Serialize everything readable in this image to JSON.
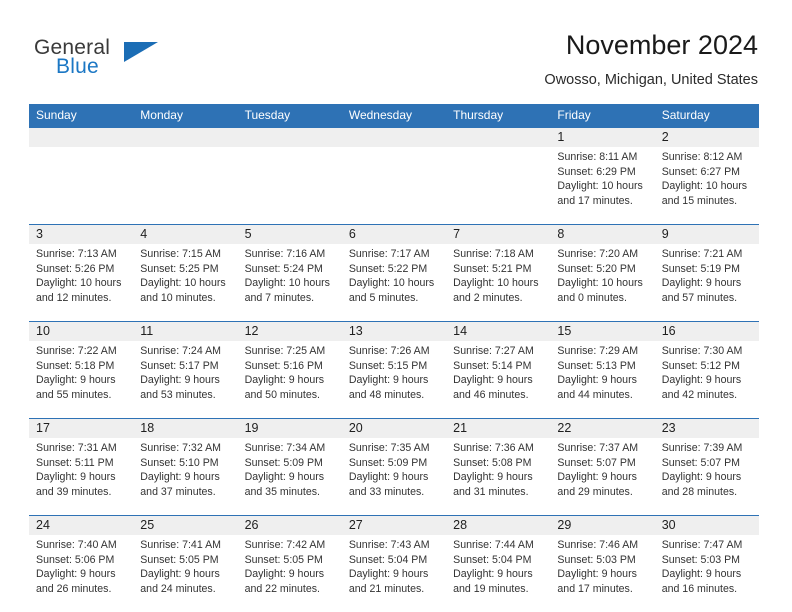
{
  "brand": {
    "name_top": "General",
    "name_bottom": "Blue",
    "logo_icon": "triangle-flag-icon",
    "accent_color": "#1b77c4"
  },
  "header": {
    "title": "November 2024",
    "location": "Owosso, Michigan, United States"
  },
  "theme": {
    "header_blue": "#2e72b5",
    "row_band_gray": "#efefef",
    "text": "#333333"
  },
  "weekday_headers": [
    "Sunday",
    "Monday",
    "Tuesday",
    "Wednesday",
    "Thursday",
    "Friday",
    "Saturday"
  ],
  "weeks": [
    {
      "days": [
        {
          "date": "",
          "empty": true,
          "sunrise": "",
          "sunset": "",
          "daylight_1": "",
          "daylight_2": ""
        },
        {
          "date": "",
          "empty": true,
          "sunrise": "",
          "sunset": "",
          "daylight_1": "",
          "daylight_2": ""
        },
        {
          "date": "",
          "empty": true,
          "sunrise": "",
          "sunset": "",
          "daylight_1": "",
          "daylight_2": ""
        },
        {
          "date": "",
          "empty": true,
          "sunrise": "",
          "sunset": "",
          "daylight_1": "",
          "daylight_2": ""
        },
        {
          "date": "",
          "empty": true,
          "sunrise": "",
          "sunset": "",
          "daylight_1": "",
          "daylight_2": ""
        },
        {
          "date": "1",
          "empty": false,
          "sunrise": "Sunrise: 8:11 AM",
          "sunset": "Sunset: 6:29 PM",
          "daylight_1": "Daylight: 10 hours",
          "daylight_2": "and 17 minutes."
        },
        {
          "date": "2",
          "empty": false,
          "sunrise": "Sunrise: 8:12 AM",
          "sunset": "Sunset: 6:27 PM",
          "daylight_1": "Daylight: 10 hours",
          "daylight_2": "and 15 minutes."
        }
      ]
    },
    {
      "days": [
        {
          "date": "3",
          "empty": false,
          "sunrise": "Sunrise: 7:13 AM",
          "sunset": "Sunset: 5:26 PM",
          "daylight_1": "Daylight: 10 hours",
          "daylight_2": "and 12 minutes."
        },
        {
          "date": "4",
          "empty": false,
          "sunrise": "Sunrise: 7:15 AM",
          "sunset": "Sunset: 5:25 PM",
          "daylight_1": "Daylight: 10 hours",
          "daylight_2": "and 10 minutes."
        },
        {
          "date": "5",
          "empty": false,
          "sunrise": "Sunrise: 7:16 AM",
          "sunset": "Sunset: 5:24 PM",
          "daylight_1": "Daylight: 10 hours",
          "daylight_2": "and 7 minutes."
        },
        {
          "date": "6",
          "empty": false,
          "sunrise": "Sunrise: 7:17 AM",
          "sunset": "Sunset: 5:22 PM",
          "daylight_1": "Daylight: 10 hours",
          "daylight_2": "and 5 minutes."
        },
        {
          "date": "7",
          "empty": false,
          "sunrise": "Sunrise: 7:18 AM",
          "sunset": "Sunset: 5:21 PM",
          "daylight_1": "Daylight: 10 hours",
          "daylight_2": "and 2 minutes."
        },
        {
          "date": "8",
          "empty": false,
          "sunrise": "Sunrise: 7:20 AM",
          "sunset": "Sunset: 5:20 PM",
          "daylight_1": "Daylight: 10 hours",
          "daylight_2": "and 0 minutes."
        },
        {
          "date": "9",
          "empty": false,
          "sunrise": "Sunrise: 7:21 AM",
          "sunset": "Sunset: 5:19 PM",
          "daylight_1": "Daylight: 9 hours",
          "daylight_2": "and 57 minutes."
        }
      ]
    },
    {
      "days": [
        {
          "date": "10",
          "empty": false,
          "sunrise": "Sunrise: 7:22 AM",
          "sunset": "Sunset: 5:18 PM",
          "daylight_1": "Daylight: 9 hours",
          "daylight_2": "and 55 minutes."
        },
        {
          "date": "11",
          "empty": false,
          "sunrise": "Sunrise: 7:24 AM",
          "sunset": "Sunset: 5:17 PM",
          "daylight_1": "Daylight: 9 hours",
          "daylight_2": "and 53 minutes."
        },
        {
          "date": "12",
          "empty": false,
          "sunrise": "Sunrise: 7:25 AM",
          "sunset": "Sunset: 5:16 PM",
          "daylight_1": "Daylight: 9 hours",
          "daylight_2": "and 50 minutes."
        },
        {
          "date": "13",
          "empty": false,
          "sunrise": "Sunrise: 7:26 AM",
          "sunset": "Sunset: 5:15 PM",
          "daylight_1": "Daylight: 9 hours",
          "daylight_2": "and 48 minutes."
        },
        {
          "date": "14",
          "empty": false,
          "sunrise": "Sunrise: 7:27 AM",
          "sunset": "Sunset: 5:14 PM",
          "daylight_1": "Daylight: 9 hours",
          "daylight_2": "and 46 minutes."
        },
        {
          "date": "15",
          "empty": false,
          "sunrise": "Sunrise: 7:29 AM",
          "sunset": "Sunset: 5:13 PM",
          "daylight_1": "Daylight: 9 hours",
          "daylight_2": "and 44 minutes."
        },
        {
          "date": "16",
          "empty": false,
          "sunrise": "Sunrise: 7:30 AM",
          "sunset": "Sunset: 5:12 PM",
          "daylight_1": "Daylight: 9 hours",
          "daylight_2": "and 42 minutes."
        }
      ]
    },
    {
      "days": [
        {
          "date": "17",
          "empty": false,
          "sunrise": "Sunrise: 7:31 AM",
          "sunset": "Sunset: 5:11 PM",
          "daylight_1": "Daylight: 9 hours",
          "daylight_2": "and 39 minutes."
        },
        {
          "date": "18",
          "empty": false,
          "sunrise": "Sunrise: 7:32 AM",
          "sunset": "Sunset: 5:10 PM",
          "daylight_1": "Daylight: 9 hours",
          "daylight_2": "and 37 minutes."
        },
        {
          "date": "19",
          "empty": false,
          "sunrise": "Sunrise: 7:34 AM",
          "sunset": "Sunset: 5:09 PM",
          "daylight_1": "Daylight: 9 hours",
          "daylight_2": "and 35 minutes."
        },
        {
          "date": "20",
          "empty": false,
          "sunrise": "Sunrise: 7:35 AM",
          "sunset": "Sunset: 5:09 PM",
          "daylight_1": "Daylight: 9 hours",
          "daylight_2": "and 33 minutes."
        },
        {
          "date": "21",
          "empty": false,
          "sunrise": "Sunrise: 7:36 AM",
          "sunset": "Sunset: 5:08 PM",
          "daylight_1": "Daylight: 9 hours",
          "daylight_2": "and 31 minutes."
        },
        {
          "date": "22",
          "empty": false,
          "sunrise": "Sunrise: 7:37 AM",
          "sunset": "Sunset: 5:07 PM",
          "daylight_1": "Daylight: 9 hours",
          "daylight_2": "and 29 minutes."
        },
        {
          "date": "23",
          "empty": false,
          "sunrise": "Sunrise: 7:39 AM",
          "sunset": "Sunset: 5:07 PM",
          "daylight_1": "Daylight: 9 hours",
          "daylight_2": "and 28 minutes."
        }
      ]
    },
    {
      "days": [
        {
          "date": "24",
          "empty": false,
          "sunrise": "Sunrise: 7:40 AM",
          "sunset": "Sunset: 5:06 PM",
          "daylight_1": "Daylight: 9 hours",
          "daylight_2": "and 26 minutes."
        },
        {
          "date": "25",
          "empty": false,
          "sunrise": "Sunrise: 7:41 AM",
          "sunset": "Sunset: 5:05 PM",
          "daylight_1": "Daylight: 9 hours",
          "daylight_2": "and 24 minutes."
        },
        {
          "date": "26",
          "empty": false,
          "sunrise": "Sunrise: 7:42 AM",
          "sunset": "Sunset: 5:05 PM",
          "daylight_1": "Daylight: 9 hours",
          "daylight_2": "and 22 minutes."
        },
        {
          "date": "27",
          "empty": false,
          "sunrise": "Sunrise: 7:43 AM",
          "sunset": "Sunset: 5:04 PM",
          "daylight_1": "Daylight: 9 hours",
          "daylight_2": "and 21 minutes."
        },
        {
          "date": "28",
          "empty": false,
          "sunrise": "Sunrise: 7:44 AM",
          "sunset": "Sunset: 5:04 PM",
          "daylight_1": "Daylight: 9 hours",
          "daylight_2": "and 19 minutes."
        },
        {
          "date": "29",
          "empty": false,
          "sunrise": "Sunrise: 7:46 AM",
          "sunset": "Sunset: 5:03 PM",
          "daylight_1": "Daylight: 9 hours",
          "daylight_2": "and 17 minutes."
        },
        {
          "date": "30",
          "empty": false,
          "sunrise": "Sunrise: 7:47 AM",
          "sunset": "Sunset: 5:03 PM",
          "daylight_1": "Daylight: 9 hours",
          "daylight_2": "and 16 minutes."
        }
      ]
    }
  ]
}
